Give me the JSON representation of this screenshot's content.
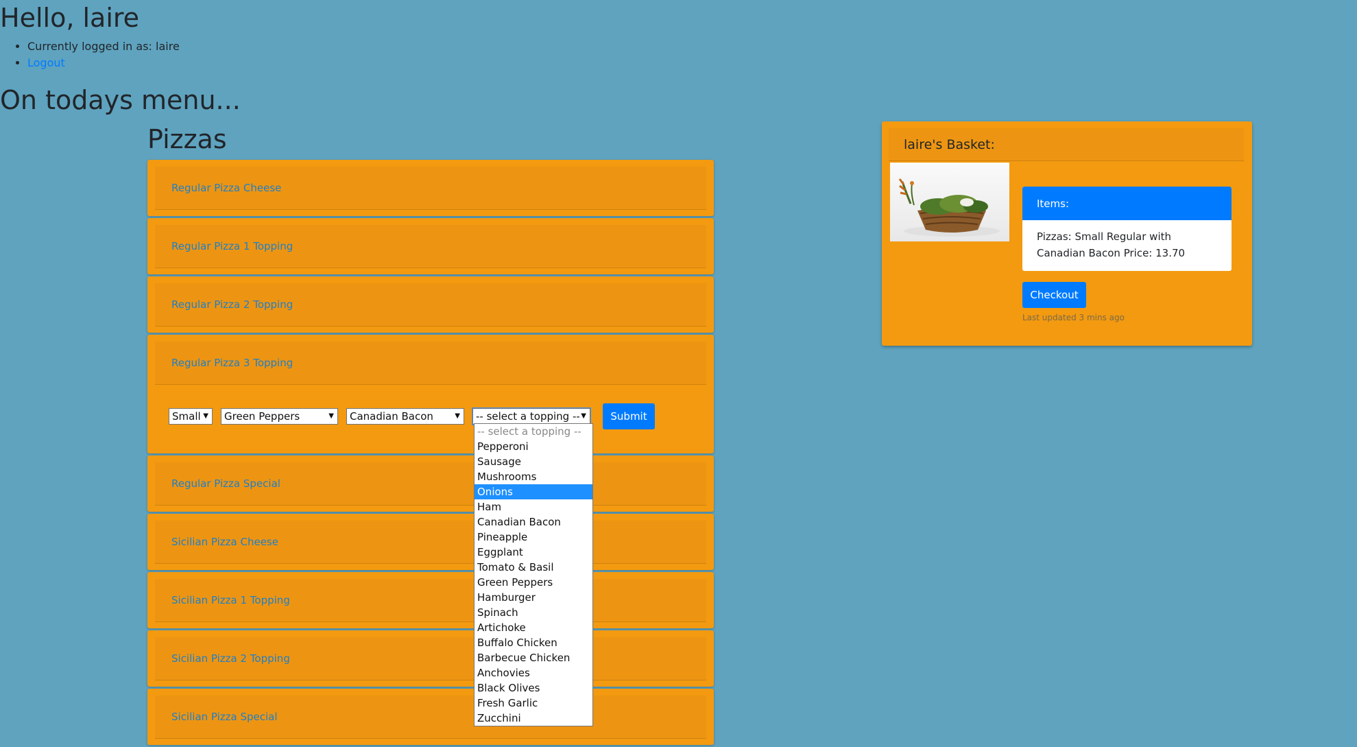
{
  "header": {
    "greeting": "Hello, laire",
    "logged_in_text": "Currently logged in as: laire",
    "logout_label": "Logout"
  },
  "menu": {
    "heading": "On todays menu...",
    "section_title": "Pizzas",
    "items": [
      "Regular Pizza Cheese",
      "Regular Pizza 1 Topping",
      "Regular Pizza 2 Topping",
      "Regular Pizza 3 Topping",
      "Regular Pizza Special",
      "Sicilian Pizza Cheese",
      "Sicilian Pizza 1 Topping",
      "Sicilian Pizza 2 Topping",
      "Sicilian Pizza Special"
    ]
  },
  "order_form": {
    "size": "Small",
    "topping1": "Green Peppers",
    "topping2": "Canadian Bacon",
    "topping3": "-- select a topping --",
    "submit_label": "Submit"
  },
  "topping_dropdown": {
    "placeholder": "-- select a topping --",
    "options": [
      "Pepperoni",
      "Sausage",
      "Mushrooms",
      "Onions",
      "Ham",
      "Canadian Bacon",
      "Pineapple",
      "Eggplant",
      "Tomato & Basil",
      "Green Peppers",
      "Hamburger",
      "Spinach",
      "Artichoke",
      "Buffalo Chicken",
      "Barbecue Chicken",
      "Anchovies",
      "Black Olives",
      "Fresh Garlic",
      "Zucchini"
    ],
    "highlighted": "Onions"
  },
  "basket": {
    "title": "laire's Basket:",
    "items_header": "Items:",
    "items_text": "Pizzas: Small Regular with Canadian Bacon Price: 13.70",
    "checkout_label": "Checkout",
    "last_updated": "Last updated 3 mins ago"
  },
  "colors": {
    "background": "#5fa3bf",
    "card": "#f39a10",
    "accent": "#007bff",
    "link": "#1f7fc9"
  }
}
